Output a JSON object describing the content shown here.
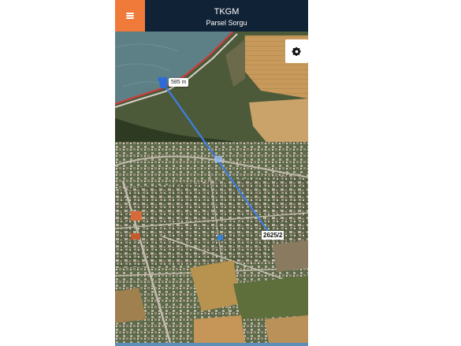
{
  "header": {
    "title": "TKGM",
    "subtitle": "Parsel Sorgu",
    "menu_icon": "hamburger-menu-icon"
  },
  "map": {
    "settings_icon": "gear-icon",
    "measurement": {
      "distance_label": "585 m"
    },
    "parcel": {
      "label": "2625/2"
    }
  },
  "colors": {
    "header_bg": "#102236",
    "menu_button_bg": "#ef7a3a",
    "measure_line": "#3f7fe0",
    "sea": "#5d7f86"
  }
}
